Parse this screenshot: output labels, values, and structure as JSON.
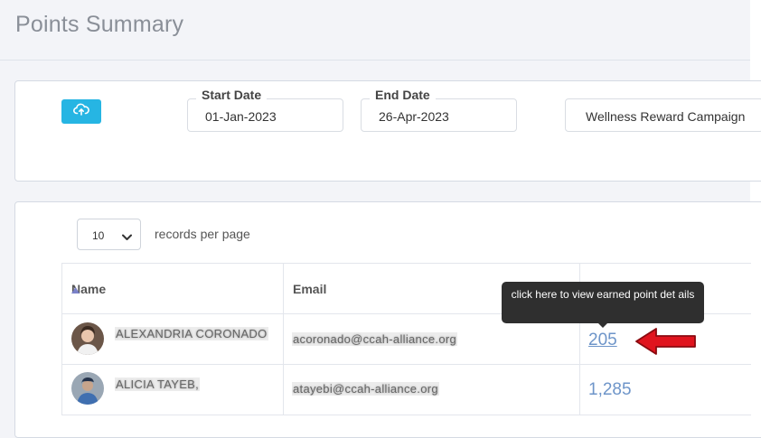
{
  "page": {
    "title": "Points Summary"
  },
  "filters": {
    "start_date": {
      "label": "Start Date",
      "value": "01-Jan-2023"
    },
    "end_date": {
      "label": "End Date",
      "value": "26-Apr-2023"
    },
    "campaign": {
      "value": "Wellness Reward Campaign"
    },
    "upload_icon": "cloud-upload-icon"
  },
  "table_controls": {
    "page_size": "10",
    "records_label": "records per page"
  },
  "table": {
    "columns": [
      "Name",
      "Email"
    ],
    "sort": {
      "column": "Name",
      "direction": "ascending"
    },
    "rows": [
      {
        "name": "ALEXANDRIA CORONADO",
        "email": "acoronado@ccah-alliance.org",
        "points": "205"
      },
      {
        "name": "ALICIA TAYEB,",
        "email": "atayebi@ccah-alliance.org",
        "points": "1,285"
      }
    ]
  },
  "tooltip": {
    "text": "click here to view earned point det ails"
  },
  "colors": {
    "accent": "#26b5e3",
    "link": "#6e95c9",
    "arrow": "#e0141e"
  }
}
